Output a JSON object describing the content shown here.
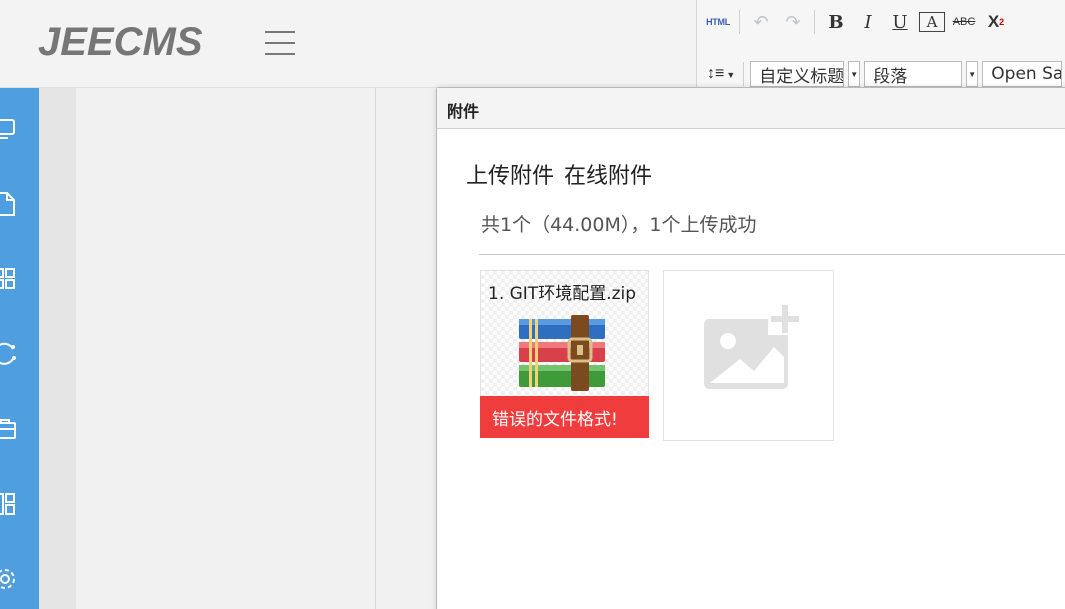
{
  "header": {
    "logo": "JEECMS"
  },
  "editor": {
    "html_label": "HTML",
    "bold_label": "B",
    "italic_label": "I",
    "underline_label": "U",
    "fontcolor_label": "A",
    "strike_label": "ABC",
    "sup_label": "X",
    "custom_title_select": "自定义标题",
    "paragraph_select": "段落",
    "font_select": "Open Sans"
  },
  "sidebar": {
    "icons": [
      "monitor-icon",
      "document-icon",
      "grid-icon",
      "refresh-icon",
      "briefcase-icon",
      "layout-icon",
      "gear-icon"
    ]
  },
  "dialog": {
    "title": "附件",
    "tabs": [
      {
        "label": "上传附件"
      },
      {
        "label": "在线附件"
      }
    ],
    "status": "共1个（44.00M），1个上传成功",
    "file": {
      "name": "1. GIT环境配置.zip",
      "error": "错误的文件格式!"
    }
  }
}
